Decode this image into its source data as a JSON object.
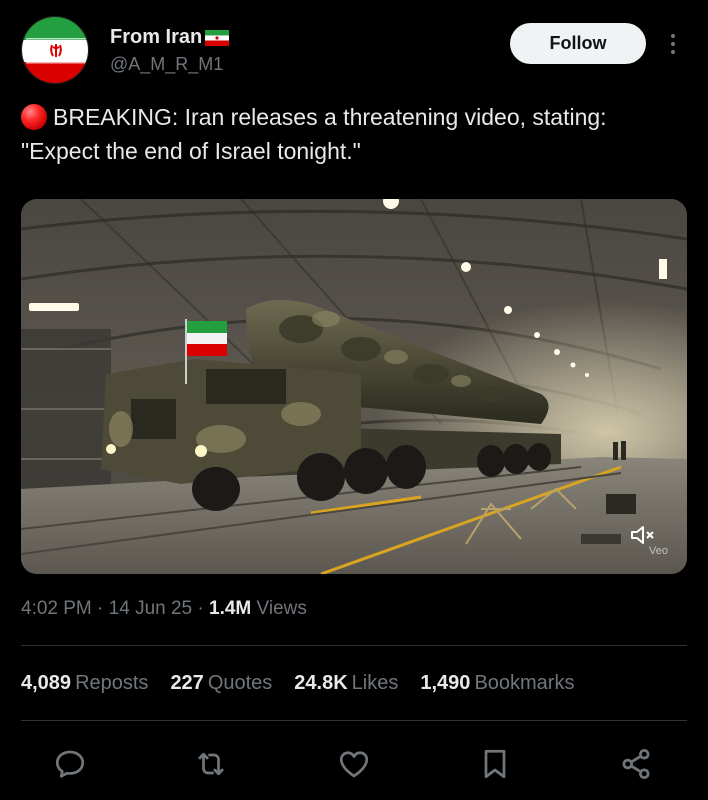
{
  "author": {
    "display_name": "From Iran",
    "handle": "@A_M_R_M1",
    "avatar_icon": "iran-flag-avatar",
    "name_badge_icon": "iran-flag-icon"
  },
  "follow_label": "Follow",
  "tweet": {
    "breaking_icon": "red-circle-icon",
    "text": "BREAKING: Iran releases a threatening video, stating: \"Expect the end of Israel tonight.\""
  },
  "media": {
    "description_icon": "video-thumbnail",
    "mute_icon": "muted-speaker-icon",
    "watermark": "Veo"
  },
  "meta": {
    "time": "4:02 PM",
    "date": "14 Jun 25",
    "views_count": "1.4M",
    "views_label": "Views"
  },
  "stats": {
    "reposts_count": "4,089",
    "reposts_label": "Reposts",
    "quotes_count": "227",
    "quotes_label": "Quotes",
    "likes_count": "24.8K",
    "likes_label": "Likes",
    "bookmarks_count": "1,490",
    "bookmarks_label": "Bookmarks"
  },
  "actions": [
    "reply-icon",
    "repost-icon",
    "like-icon",
    "bookmark-icon",
    "share-icon"
  ],
  "colors": {
    "background": "#000000",
    "text": "#e7e9ea",
    "secondary": "#71767b",
    "divider": "#2f3336",
    "follow_bg": "#eff3f4",
    "iran_green": "#239f40",
    "iran_red": "#da0000"
  }
}
